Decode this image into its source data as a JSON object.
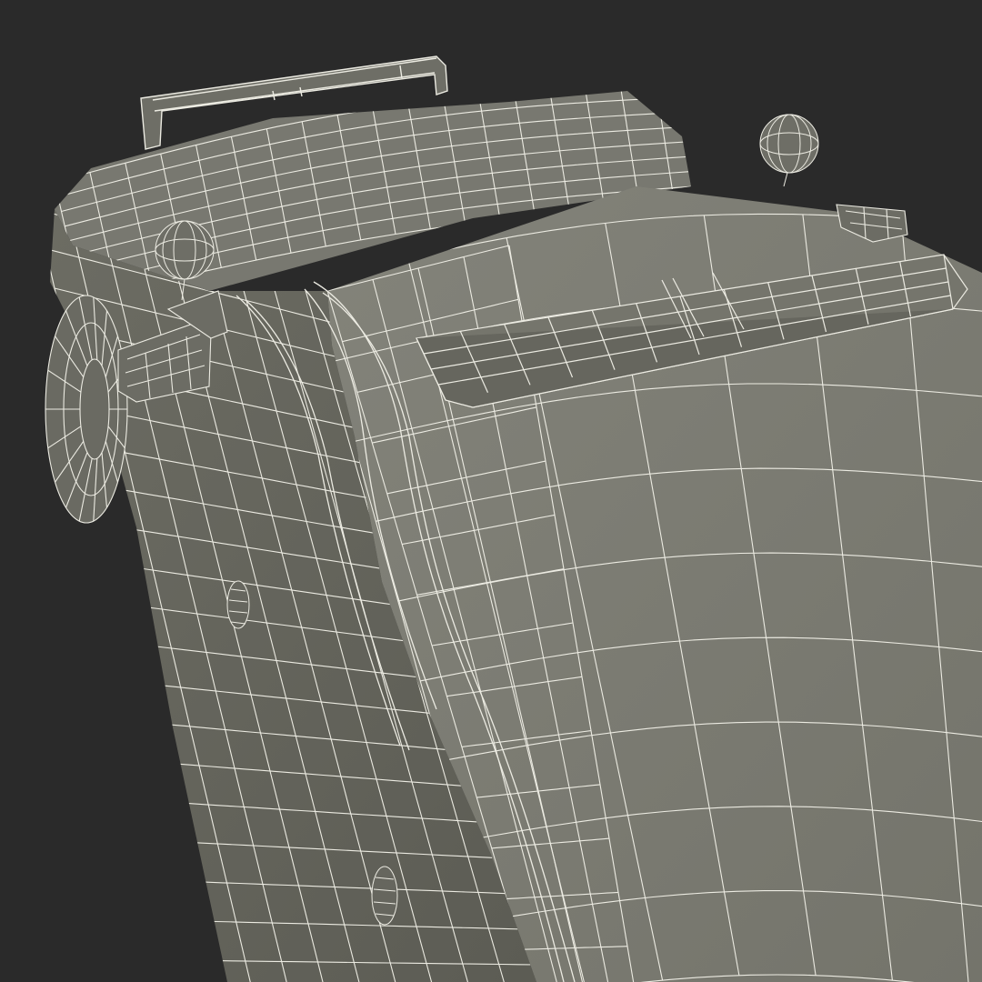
{
  "scene": {
    "subject": "wireframe-car-model",
    "colors": {
      "background": "#2a2a2a",
      "body": "#7a7a70",
      "body_shadow": "#5f5f57",
      "body_light": "#8a8a80",
      "wire": "#ecebe2"
    }
  }
}
